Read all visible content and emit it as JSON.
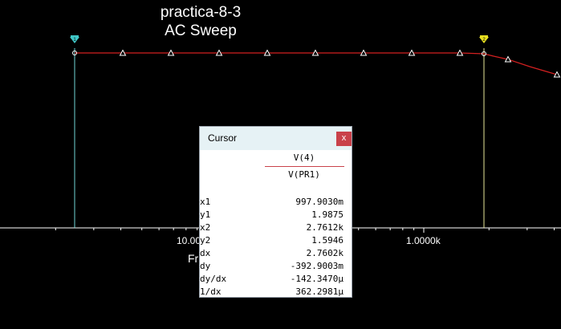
{
  "plot": {
    "title_line1": "practica-8-3",
    "title_line2": "AC Sweep",
    "x_tick_labels": [
      "10.00",
      "1.0000k"
    ],
    "x_axis_label_fragment": "Fr",
    "colors": {
      "background": "#000000",
      "trace": "#d42020",
      "cursor1": "#6fd6d6",
      "cursor2": "#e8e89a",
      "cursor1_marker": "#40c8c8",
      "cursor2_marker": "#e8e020"
    },
    "cursor1_marker_label": "1",
    "cursor2_marker_label": "2"
  },
  "cursor_dialog": {
    "title": "Cursor",
    "close_label": "x",
    "header_top": "V(4)",
    "header_bottom": "V(PR1)",
    "rows": [
      {
        "label": "x1",
        "value": "997.9030m"
      },
      {
        "label": "y1",
        "value": "1.9875"
      },
      {
        "label": "x2",
        "value": "2.7612k"
      },
      {
        "label": "y2",
        "value": "1.5946"
      },
      {
        "label": "dx",
        "value": "2.7602k"
      },
      {
        "label": "dy",
        "value": "-392.9003m"
      },
      {
        "label": "dy/dx",
        "value": "-142.3470μ"
      },
      {
        "label": "1/dx",
        "value": "362.2981μ"
      }
    ]
  }
}
